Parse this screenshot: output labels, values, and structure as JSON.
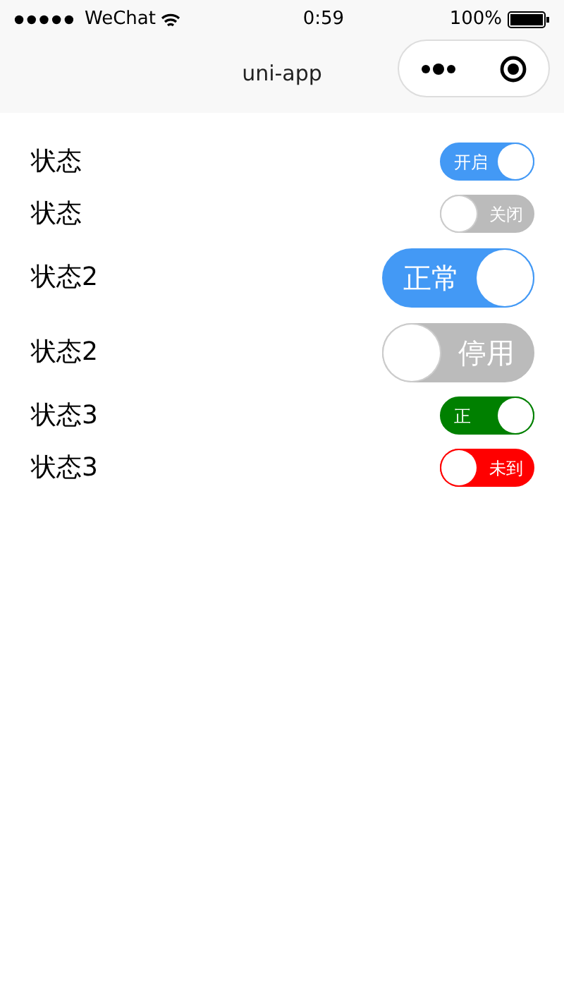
{
  "status_bar": {
    "carrier": "WeChat",
    "time": "0:59",
    "battery": "100%"
  },
  "nav_bar": {
    "title": "uni-app"
  },
  "rows": [
    {
      "label": "状态",
      "kind": "small",
      "on": true,
      "color": "#4399f5",
      "switch_text": "开启"
    },
    {
      "label": "状态",
      "kind": "small",
      "on": false,
      "color": "#bbbbbb",
      "switch_text": "关闭"
    },
    {
      "label": "状态2",
      "kind": "large",
      "on": true,
      "color": "#4399f5",
      "switch_text": "正常"
    },
    {
      "label": "状态2",
      "kind": "large",
      "on": false,
      "color": "#bbbbbb",
      "switch_text": "停用"
    },
    {
      "label": "状态3",
      "kind": "small",
      "on": true,
      "color": "#008000",
      "switch_text": "正"
    },
    {
      "label": "状态3",
      "kind": "small",
      "on": false,
      "color": "#ff0000",
      "switch_text": "未到"
    }
  ]
}
